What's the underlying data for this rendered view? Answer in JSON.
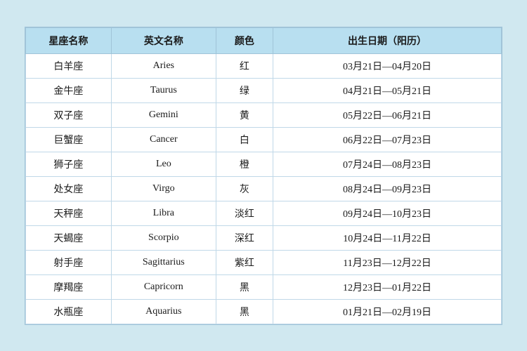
{
  "table": {
    "headers": [
      {
        "key": "chinese_name",
        "label": "星座名称"
      },
      {
        "key": "english_name",
        "label": "英文名称"
      },
      {
        "key": "color",
        "label": "颜色"
      },
      {
        "key": "birth_date",
        "label": "出生日期（阳历）"
      }
    ],
    "rows": [
      {
        "chinese": "白羊座",
        "english": "Aries",
        "color": "红",
        "date": "03月21日—04月20日"
      },
      {
        "chinese": "金牛座",
        "english": "Taurus",
        "color": "绿",
        "date": "04月21日—05月21日"
      },
      {
        "chinese": "双子座",
        "english": "Gemini",
        "color": "黄",
        "date": "05月22日—06月21日"
      },
      {
        "chinese": "巨蟹座",
        "english": "Cancer",
        "color": "白",
        "date": "06月22日—07月23日"
      },
      {
        "chinese": "狮子座",
        "english": "Leo",
        "color": "橙",
        "date": "07月24日—08月23日"
      },
      {
        "chinese": "处女座",
        "english": "Virgo",
        "color": "灰",
        "date": "08月24日—09月23日"
      },
      {
        "chinese": "天秤座",
        "english": "Libra",
        "color": "淡红",
        "date": "09月24日—10月23日"
      },
      {
        "chinese": "天蝎座",
        "english": "Scorpio",
        "color": "深红",
        "date": "10月24日—11月22日"
      },
      {
        "chinese": "射手座",
        "english": "Sagittarius",
        "color": "紫红",
        "date": "11月23日—12月22日"
      },
      {
        "chinese": "摩羯座",
        "english": "Capricorn",
        "color": "黑",
        "date": "12月23日—01月22日"
      },
      {
        "chinese": "水瓶座",
        "english": "Aquarius",
        "color": "黑",
        "date": "01月21日—02月19日"
      }
    ]
  }
}
